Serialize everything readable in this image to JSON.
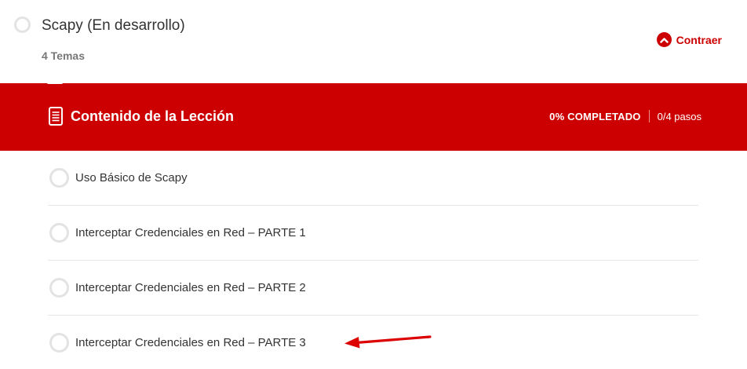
{
  "lesson": {
    "title": "Scapy (En desarrollo)",
    "topics_count": "4 Temas",
    "collapse_label": "Contraer"
  },
  "content": {
    "title": "Contenido de la Lección",
    "progress_percent": "0% COMPLETADO",
    "progress_steps": "0/4 pasos"
  },
  "topics": [
    {
      "label": "Uso Básico de Scapy"
    },
    {
      "label": "Interceptar Credenciales en Red – PARTE 1"
    },
    {
      "label": "Interceptar Credenciales en Red – PARTE 2"
    },
    {
      "label": "Interceptar Credenciales en Red – PARTE 3"
    }
  ],
  "icons": {
    "lesson_status": "circle-outline-icon",
    "collapse": "chevron-up-icon",
    "content": "document-icon",
    "topic_status": "circle-outline-icon",
    "annotation": "arrow-left-icon"
  },
  "colors": {
    "accent": "#cc0000",
    "circle": "#e3e3e3",
    "text": "#333333",
    "muted": "#777777",
    "annotation": "#dd0000"
  }
}
